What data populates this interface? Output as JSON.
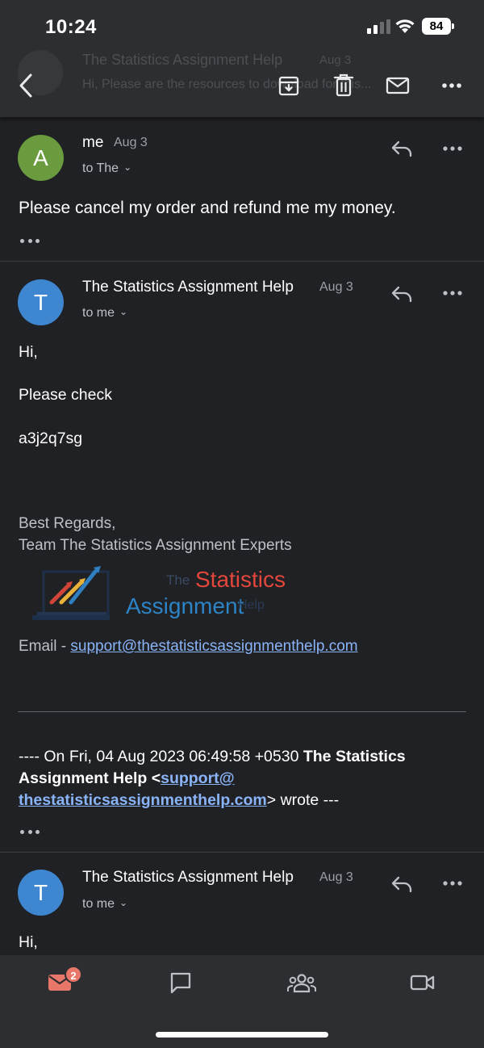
{
  "status_bar": {
    "time": "10:24",
    "battery": "84"
  },
  "background_thread": {
    "sender": "The Statistics Assignment Help",
    "date": "Aug 3",
    "snippet": "Hi, Please are the resources to download for this..."
  },
  "toolbar": {
    "back_icon": "chevron-left-icon",
    "archive_icon": "archive-icon",
    "delete_icon": "trash-icon",
    "mark_unread_icon": "mail-icon",
    "more_icon": "more-horizontal-icon"
  },
  "messages": [
    {
      "avatar_letter": "A",
      "avatar_color": "#6a9b3e",
      "sender": "me",
      "date": "Aug 3",
      "recipient": "to The",
      "body": "Please cancel my order and refund me my money."
    },
    {
      "avatar_letter": "T",
      "avatar_color": "#3e87d0",
      "sender": "The Statistics Assignment Help",
      "date": "Aug 3",
      "recipient": "to me",
      "greeting": "Hi,",
      "line1": "Please check",
      "code": "a3j2q7sg",
      "regards": "Best Regards,",
      "team": "Team The Statistics Assignment Experts",
      "logo": {
        "word_the": "The",
        "word_statistics": "Statistics",
        "word_assignment": "Assignment",
        "word_help": "Help"
      },
      "email_label": "Email - ",
      "email_link": "support@thestatisticsassignmenthelp.com",
      "quote_prefix": "---- On Fri, 04 Aug 2023 06:49:58 +0530 ",
      "quote_sender": "The Statistics Assignment Help",
      "quote_lt": " <",
      "quote_email_a": "support@",
      "quote_email_b": "thestatisticsassignmenthelp.com",
      "quote_suffix": "> wrote ---"
    },
    {
      "avatar_letter": "T",
      "avatar_color": "#3e87d0",
      "sender": "The Statistics Assignment Help",
      "date": "Aug 3",
      "recipient": "to me",
      "greeting": "Hi,"
    }
  ],
  "bottom_nav": {
    "mail_badge": "2",
    "items": [
      "mail-icon",
      "chat-icon",
      "spaces-icon",
      "meet-video-icon"
    ],
    "accent": "#e8776a"
  }
}
